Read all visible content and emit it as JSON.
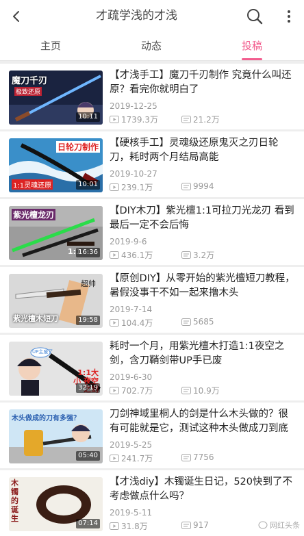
{
  "header": {
    "title": "才疏学浅的才浅",
    "icons": [
      "back-arrow-icon",
      "search-icon",
      "more-vertical-icon"
    ]
  },
  "tabs": [
    {
      "label": "主页",
      "active": false
    },
    {
      "label": "动态",
      "active": false
    },
    {
      "label": "投稿",
      "active": true
    }
  ],
  "accent_color": "#f25d8e",
  "videos": [
    {
      "title": "【才浅手工】魔刀千刃制作 究竟什么叫还原？看完你就明白了",
      "date": "2019-12-25",
      "views": "1739.3万",
      "danmaku": "21.2万",
      "duration": "10:11",
      "thumb_text": "魔刀千刃",
      "thumb_sub": "极致还原"
    },
    {
      "title": "【硬核手工】灵魂级还原鬼灭之刃日轮刀，耗时两个月结局高能",
      "date": "2019-10-27",
      "views": "239.1万",
      "danmaku": "9994",
      "duration": "10:01",
      "thumb_text": "日轮刀制作",
      "thumb_sub": "1:1灵魂还原"
    },
    {
      "title": "【DIY木刀】紫光檀1:1可拉刀光龙刃 看到最后一定不会后悔",
      "date": "2019-9-6",
      "views": "436.1万",
      "danmaku": "3.2万",
      "duration": "16:36",
      "thumb_text": "紫光檀龙刃",
      "thumb_sub": "1:1"
    },
    {
      "title": "【原创DIY】从零开始的紫光檀短刀教程，暑假没事干不如一起来撸木头",
      "date": "2019-7-14",
      "views": "104.4万",
      "danmaku": "5685",
      "duration": "19:58",
      "thumb_text": "紫光檀木短刀",
      "thumb_sub": "超帅"
    },
    {
      "title": "耗时一个月，用紫光檀木打造1:1夜空之剑，含刀鞘剑带UP手已废",
      "date": "2019-6-30",
      "views": "702.7万",
      "danmaku": "10.9万",
      "duration": "32:19",
      "thumb_text": "UP主废了",
      "thumb_sub": "1:1大小 夜空之剑"
    },
    {
      "title": "刀剑神域里桐人的剑是什么木头做的？很有可能就是它，测试这种木头做成刀到底怎样",
      "date": "2019-5-25",
      "views": "241.7万",
      "danmaku": "7756",
      "duration": "05:40",
      "thumb_text": "木头做成的刀有多强？",
      "thumb_sub": ""
    },
    {
      "title": "【才浅diy】木镯诞生日记，520快到了不考虑做点什么吗？",
      "date": "2019-5-11",
      "views": "31.8万",
      "danmaku": "917",
      "duration": "07:14",
      "thumb_text": "木镯的诞生",
      "thumb_sub": ""
    }
  ],
  "watermark": "网红头条"
}
